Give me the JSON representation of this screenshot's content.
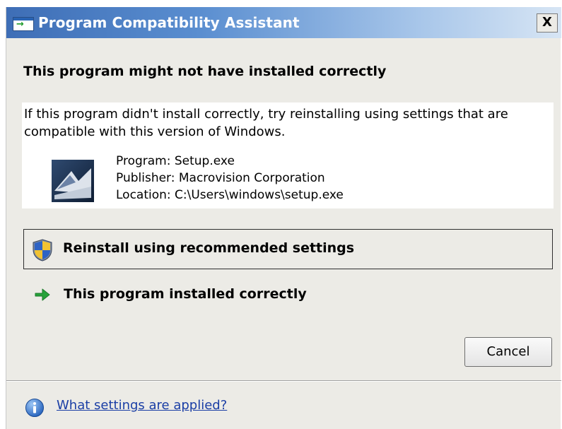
{
  "window": {
    "title": "Program Compatibility Assistant",
    "close_label": "X"
  },
  "dialog": {
    "heading": "This program might not have installed correctly",
    "description": "If this program didn't install correctly, try reinstalling using settings that are compatible with this version of Windows.",
    "program": "Program: Setup.exe",
    "publisher": "Publisher: Macrovision Corporation",
    "location": "Location: C:\\Users\\windows\\setup.exe"
  },
  "options": {
    "reinstall_label": "Reinstall using recommended settings",
    "installed_correctly_label": "This program installed correctly"
  },
  "buttons": {
    "cancel_label": "Cancel"
  },
  "footer": {
    "help_link": "What settings are applied?"
  },
  "icons": {
    "title": "compatibility-app-icon",
    "program": "setup-program-icon",
    "reinstall": "uac-shield-icon",
    "installed": "green-arrow-icon",
    "help": "info-icon"
  },
  "colors": {
    "titlebar_start": "#3e6eb6",
    "titlebar_end": "#d7e5f4",
    "dialog_background": "#ecebe6",
    "link": "#1a3ea5",
    "arrow_green": "#27a23a"
  }
}
